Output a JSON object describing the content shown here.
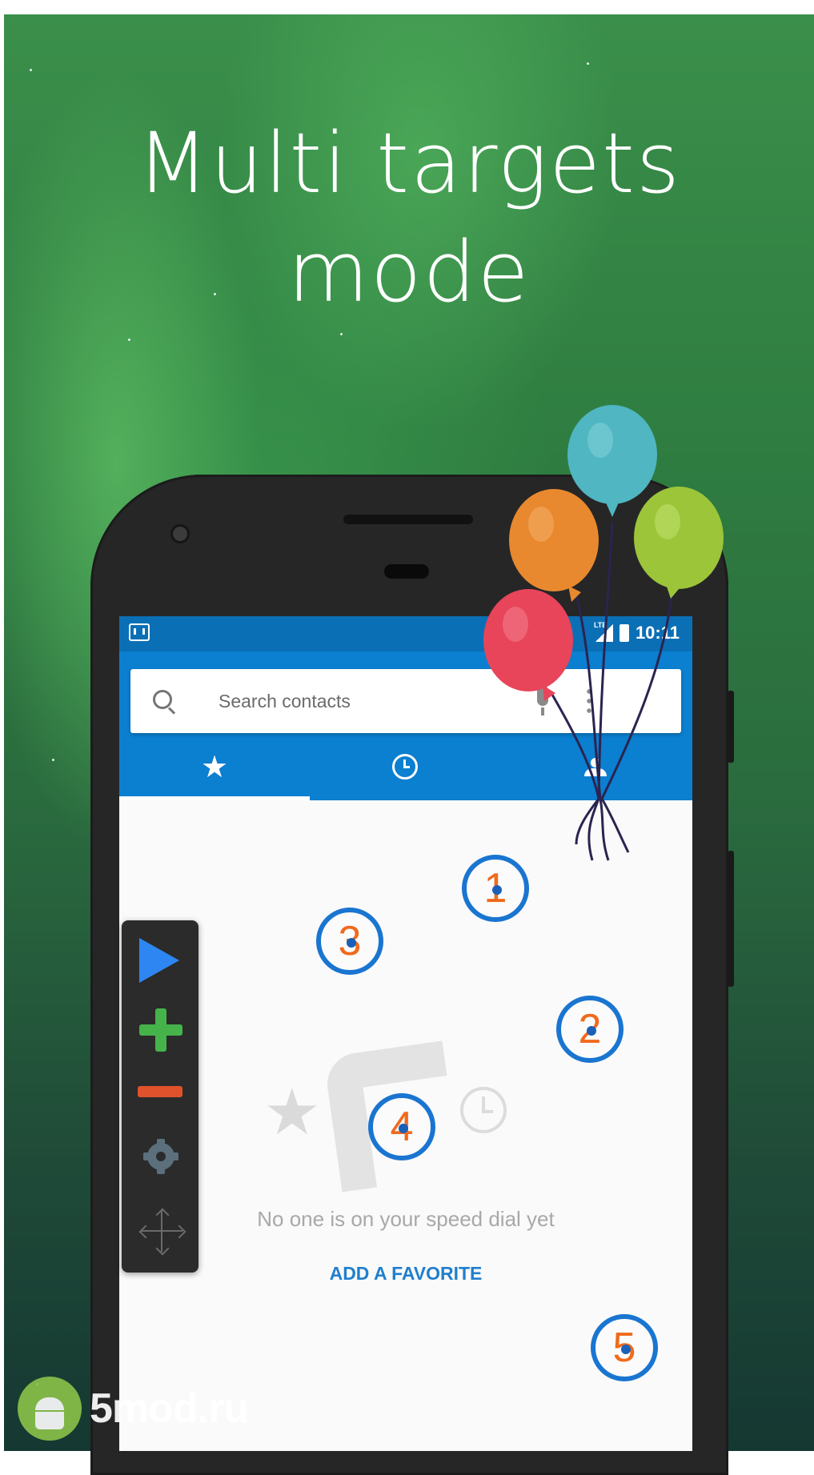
{
  "promo": {
    "headline_line1": "Multi targets",
    "headline_line2": "mode"
  },
  "status_bar": {
    "time": "10:11",
    "network": "LTE"
  },
  "search": {
    "placeholder": "Search contacts"
  },
  "tabs": [
    {
      "name": "Speed dial",
      "icon": "star-icon",
      "selected": true
    },
    {
      "name": "Recents",
      "icon": "clock-icon",
      "selected": false
    },
    {
      "name": "Contacts",
      "icon": "people-icon",
      "selected": false
    }
  ],
  "empty_state": {
    "message": "No one is on your speed dial yet",
    "action_label": "ADD A FAVORITE"
  },
  "targets": [
    {
      "label": "1"
    },
    {
      "label": "2"
    },
    {
      "label": "3"
    },
    {
      "label": "4"
    },
    {
      "label": "5"
    }
  ],
  "control_panel": {
    "buttons": [
      "play-icon",
      "plus-icon",
      "minus-icon",
      "gear-icon",
      "move-icon"
    ]
  },
  "watermark": {
    "text": "5mod.ru"
  },
  "colors": {
    "accent_blue": "#0b7fd0",
    "target_ring": "#1a75d1",
    "target_number": "#f06a1d",
    "play": "#2e86f2",
    "add": "#45b34a",
    "remove": "#e0522c"
  }
}
